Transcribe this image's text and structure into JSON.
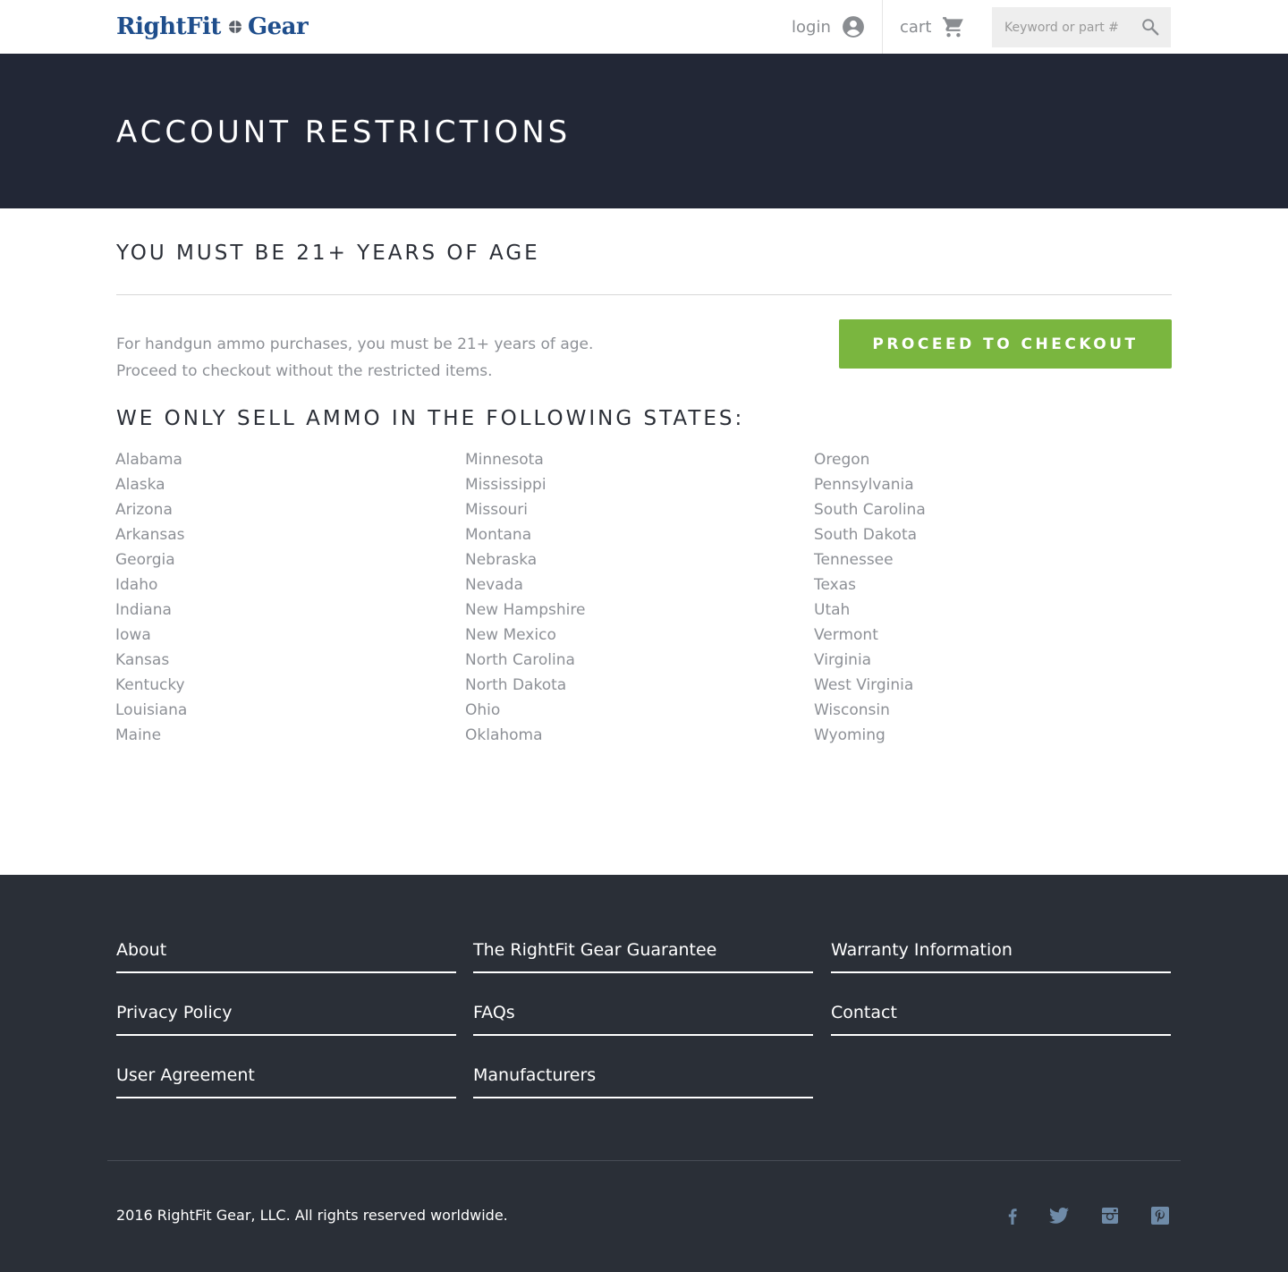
{
  "header": {
    "logo_left": "RightFit",
    "logo_right": "Gear",
    "login_label": "login",
    "cart_label": "cart",
    "search_placeholder": "Keyword or part #",
    "icons": {
      "user": "account-circle-icon",
      "cart": "shopping-cart-icon",
      "search": "search-icon",
      "logo_mark": "crosshair-icon"
    }
  },
  "hero": {
    "title": "ACCOUNT RESTRICTIONS"
  },
  "main": {
    "age_title": "YOU MUST BE 21+ YEARS OF AGE",
    "intro_line1": "For handgun ammo purchases, you must be 21+ years of age.",
    "intro_line2": "Proceed to checkout without the restricted items.",
    "checkout_button": "PROCEED TO CHECKOUT",
    "states_title": "WE ONLY SELL AMMO IN THE FOLLOWING STATES:",
    "states": [
      [
        "Alabama",
        "Alaska",
        "Arizona",
        "Arkansas",
        "Georgia",
        "Idaho",
        "Indiana",
        "Iowa",
        "Kansas",
        "Kentucky",
        "Louisiana",
        "Maine"
      ],
      [
        "Minnesota",
        "Mississippi",
        "Missouri",
        "Montana",
        "Nebraska",
        "Nevada",
        "New Hampshire",
        "New Mexico",
        "North Carolina",
        "North Dakota",
        "Ohio",
        "Oklahoma"
      ],
      [
        "Oregon",
        "Pennsylvania",
        "South Carolina",
        "South Dakota",
        "Tennessee",
        "Texas",
        "Utah",
        "Vermont",
        "Virginia",
        "West Virginia",
        "Wisconsin",
        "Wyoming"
      ]
    ]
  },
  "footer": {
    "links": {
      "about": "About",
      "guarantee": "The RightFit Gear Guarantee",
      "warranty": "Warranty Information",
      "privacy": "Privacy Policy",
      "faqs": "FAQs",
      "contact": "Contact",
      "user_agreement": "User Agreement",
      "manufacturers": "Manufacturers"
    },
    "copyright": "2016 RightFit Gear, LLC. All rights reserved worldwide.",
    "social": [
      "facebook-icon",
      "twitter-icon",
      "instagram-icon",
      "pinterest-icon"
    ],
    "social_color": "#6f8ba8"
  },
  "colors": {
    "hero_bg": "#222736",
    "footer_bg": "#2a2f37",
    "accent_green": "#7ab63f",
    "brand_blue": "#1f4e8c"
  }
}
